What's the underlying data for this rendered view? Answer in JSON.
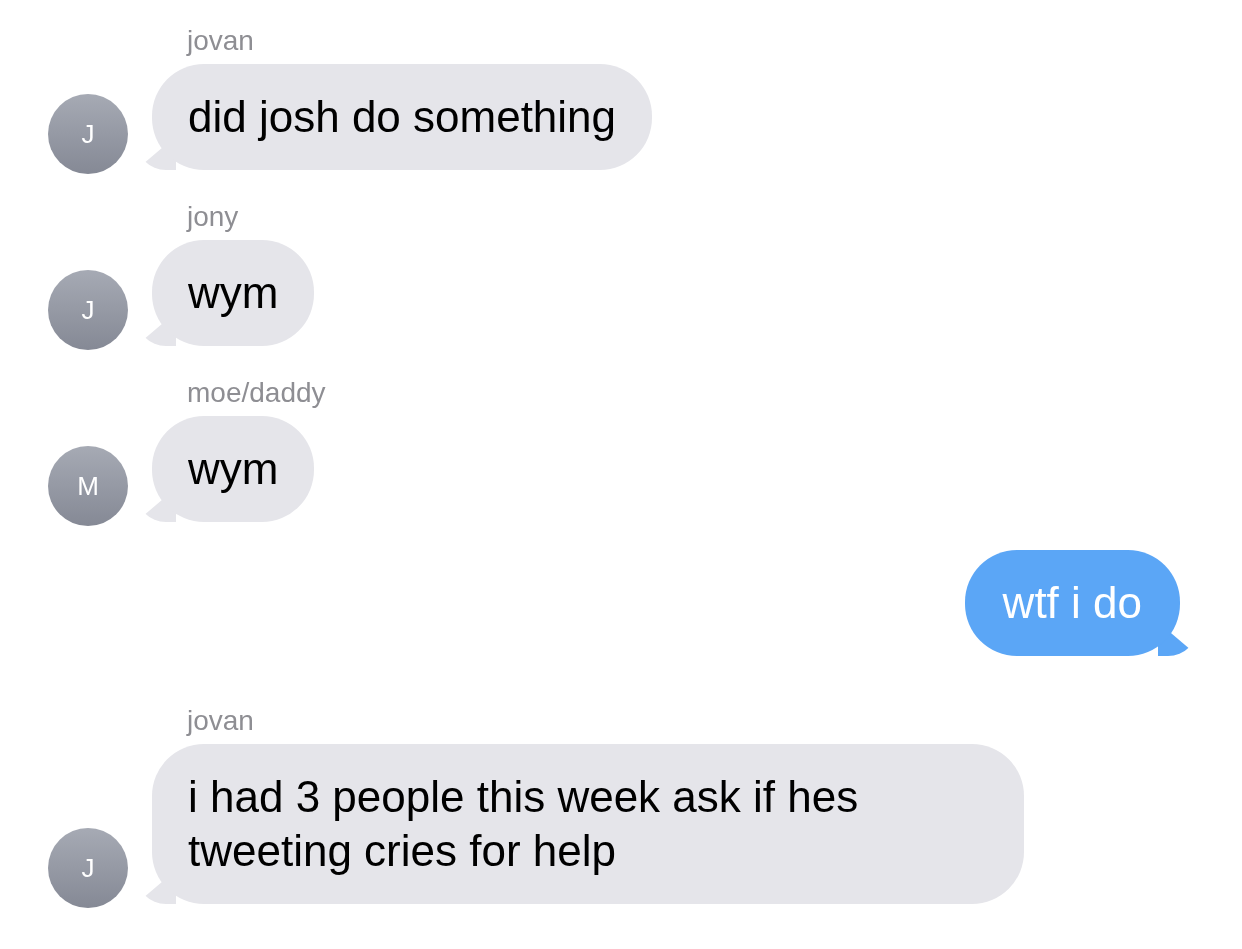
{
  "messages": [
    {
      "kind": "incoming",
      "sender": "jovan",
      "avatar_initial": "J",
      "text": "did josh do something"
    },
    {
      "kind": "incoming",
      "sender": "jony",
      "avatar_initial": "J",
      "text": "wym"
    },
    {
      "kind": "incoming",
      "sender": "moe/daddy",
      "avatar_initial": "M",
      "text": "wym"
    },
    {
      "kind": "outgoing",
      "text": "wtf i do"
    },
    {
      "kind": "incoming",
      "sender": "jovan",
      "avatar_initial": "J",
      "text": "i had 3 people this week ask if hes tweeting cries for help"
    }
  ]
}
